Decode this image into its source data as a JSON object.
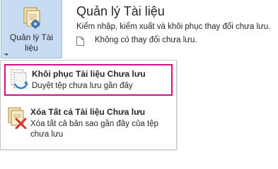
{
  "manage": {
    "label_line1": "Quản lý Tài",
    "label_line2": "liệu",
    "icon": "manage-documents-icon"
  },
  "section": {
    "title": "Quản lý Tài liệu",
    "description": "Kiểm nhập, kiểm xuất và khôi phục thay đổi chưa lưu.",
    "status": "Không có thay đổi chưa lưu.",
    "status_icon": "document-icon"
  },
  "menu": {
    "recover": {
      "title": "Khôi phục Tài liệu Chưa lưu",
      "description": "Duyệt tệp chưa lưu gần đây",
      "icon": "recover-document-icon",
      "highlight_color": "#d3108a"
    },
    "delete": {
      "title": "Xóa Tất cả Tài liệu Chưa lưu",
      "description": "Xóa tất cả bản sao gần đây của tệp chưa lưu",
      "icon": "delete-documents-icon"
    }
  },
  "colors": {
    "button_background": "#c7dcf2",
    "button_border": "#9fbfe3"
  }
}
